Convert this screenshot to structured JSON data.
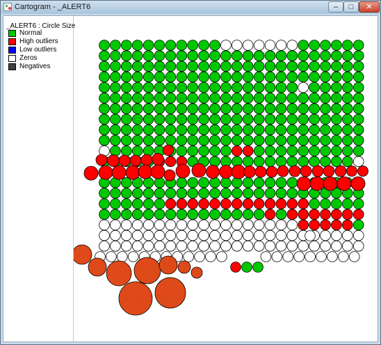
{
  "window": {
    "title": "Cartogram - _ALERT6",
    "min_glyph": "–",
    "max_glyph": "□",
    "close_glyph": "✕"
  },
  "legend": {
    "title": "_ALERT6 : Circle Size",
    "items": [
      {
        "label": "Normal",
        "color": "#00c800"
      },
      {
        "label": "High outliers",
        "color": "#ff0000"
      },
      {
        "label": "Low outliers",
        "color": "#0000ff"
      },
      {
        "label": "Zeros",
        "color": "#ffffff"
      },
      {
        "label": "Negatives",
        "color": "#404040"
      }
    ]
  },
  "colors": {
    "normal": "#00c800",
    "high": "#ff0000",
    "zero": "#ffffff",
    "large": "#f0521e"
  }
}
